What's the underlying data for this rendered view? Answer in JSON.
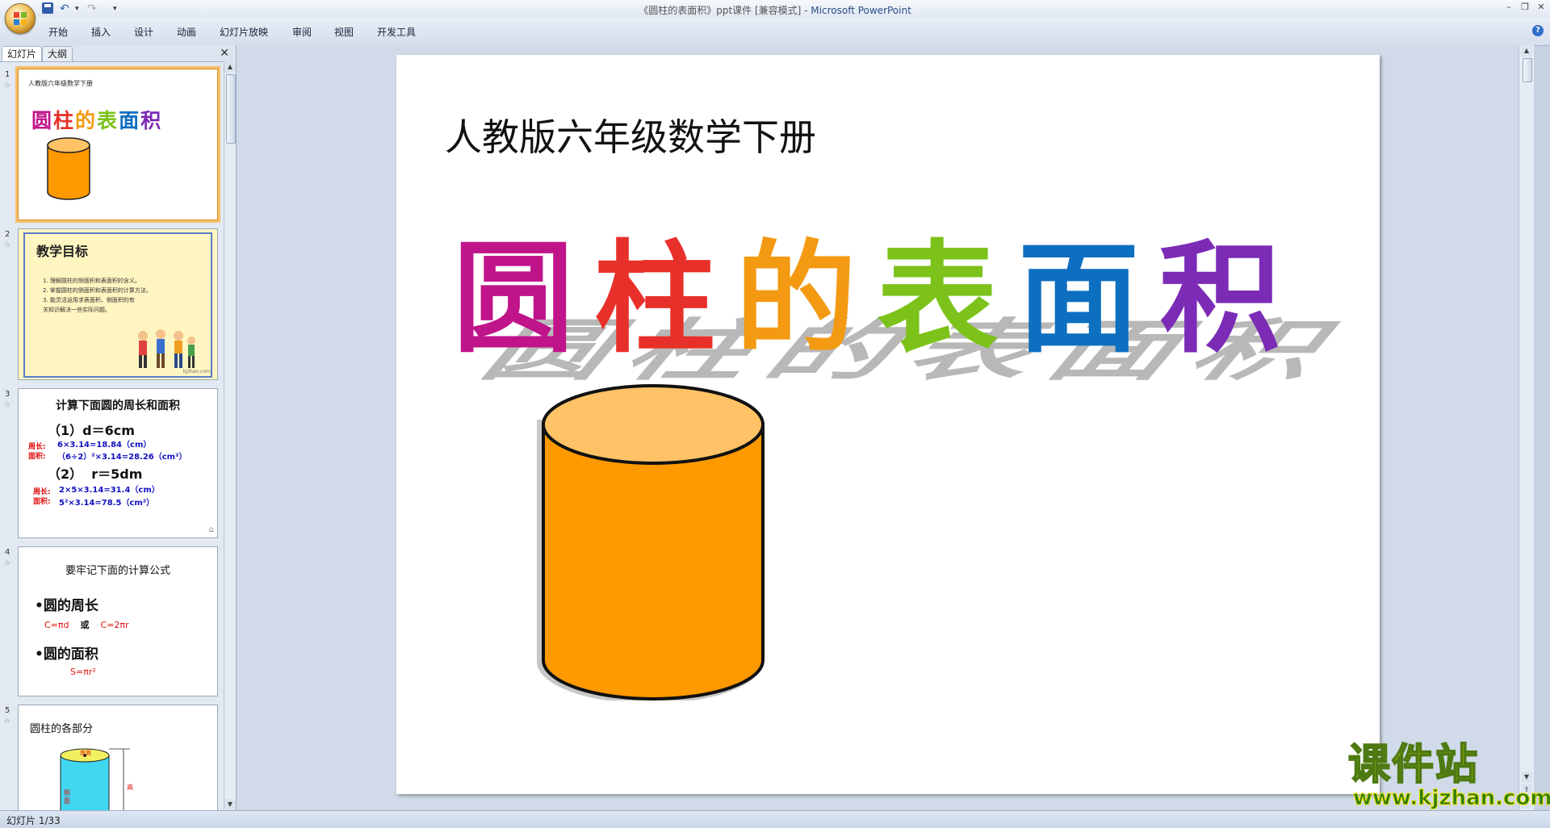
{
  "window": {
    "title_doc": "《圆柱的表面积》ppt课件 [兼容模式]",
    "title_sep": " - ",
    "title_app": "Microsoft PowerPoint"
  },
  "ribbon": {
    "tabs": [
      "开始",
      "插入",
      "设计",
      "动画",
      "幻灯片放映",
      "审阅",
      "视图",
      "开发工具"
    ]
  },
  "left_pane": {
    "tabs": [
      "幻灯片",
      "大纲"
    ]
  },
  "thumbnails": [
    {
      "num": "1",
      "line1": "人教版六年级数学下册",
      "title": "圆柱的表面积"
    },
    {
      "num": "2",
      "title": "教学目标",
      "lines": [
        "1. 理解圆柱的侧面积和表面积的含义。",
        "2. 掌握圆柱的侧面积和表面积的计算方法。",
        "3. 能灵活运用求表面积、侧面积的有",
        "关知识解决一些实际问题。"
      ],
      "footer": "kjzhan.com"
    },
    {
      "num": "3",
      "title": "计算下面圆的周长和面积",
      "q1": "（1）d＝6cm",
      "q1_l1": "周长:",
      "q1_a1": "6×3.14=18.84（cm）",
      "q1_l2": "面积:",
      "q1_a2": "（6÷2）²×3.14=28.26（cm²）",
      "q2": "（2）  r＝5dm",
      "q2_l1": "周长:",
      "q2_a1": "2×5×3.14=31.4（cm）",
      "q2_l2": "面积:",
      "q2_a2": "5²×3.14=78.5（cm²）"
    },
    {
      "num": "4",
      "title": "要牢记下面的计算公式",
      "b1": "•圆的周长",
      "f1a": "C=πd",
      "f1or": "或",
      "f1b": "C=2πr",
      "b2": "•圆的面积",
      "f2": "S=πr²"
    },
    {
      "num": "5",
      "title": "圆柱的各部分",
      "lbl_top": "底面",
      "lbl_side": "侧面",
      "lbl_h": "高"
    }
  ],
  "slide": {
    "subtitle": "人教版六年级数学下册",
    "wordart": [
      "圆",
      "柱",
      "的",
      "表",
      "面",
      "积"
    ],
    "wordart_colors": [
      "#c0148a",
      "#e8302a",
      "#f39a12",
      "#7cc21a",
      "#0c6fbf",
      "#7b2bb5"
    ]
  },
  "status": {
    "slide_info": "幻灯片 1/33"
  },
  "watermark": {
    "title": "课件站",
    "url": "www.kjzhan.com"
  }
}
